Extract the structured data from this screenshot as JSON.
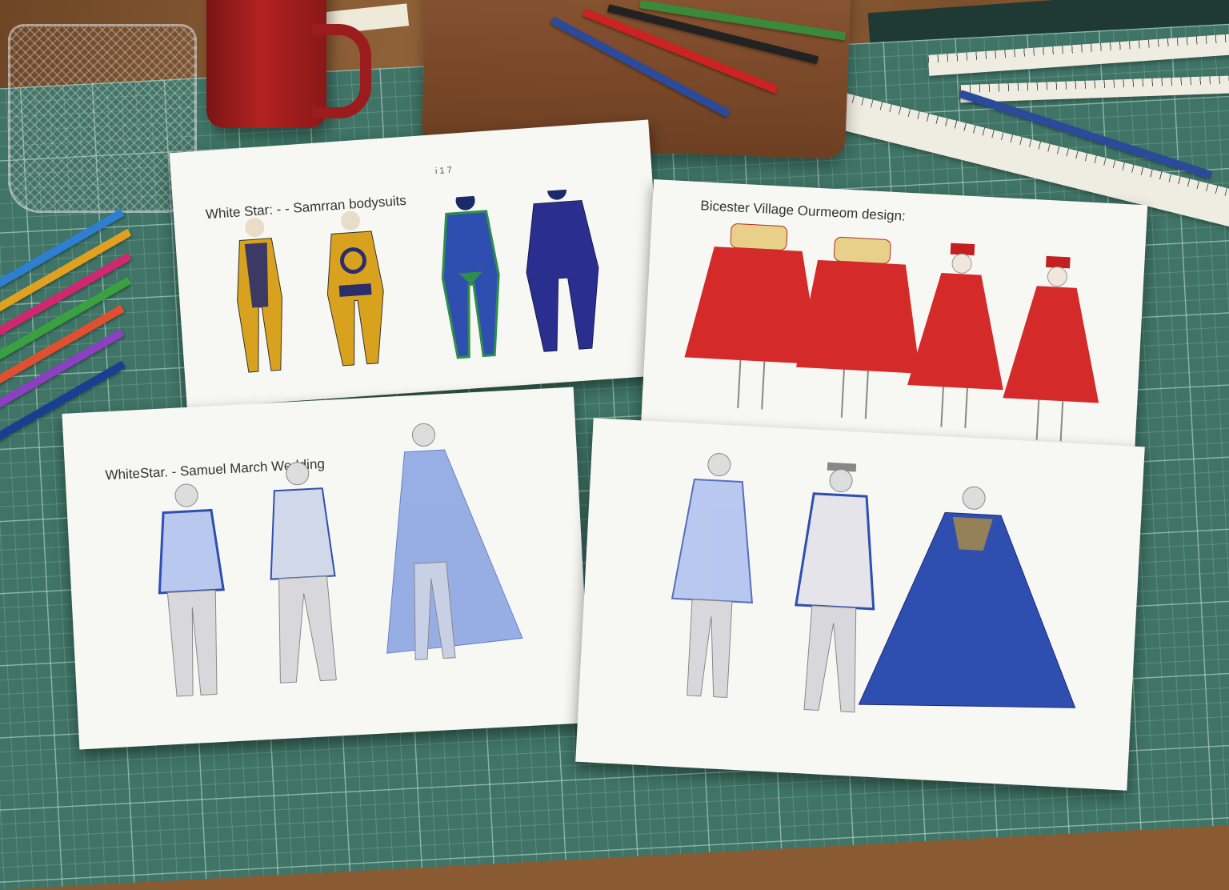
{
  "sheets": [
    {
      "title": "White Star: - - Samrran bodysuits",
      "caption": "",
      "top_marks": "i  1 7"
    },
    {
      "title": "Bicester Village Ourmeom design:",
      "caption": ""
    },
    {
      "title": "WhiteStar. - Samuel March Wedding",
      "caption": ""
    },
    {
      "title": "",
      "caption": ""
    }
  ],
  "colors": {
    "mat": "#3f7466",
    "mustard": "#d9a21e",
    "navy": "#2a2f6b",
    "royal_blue": "#2e4fb0",
    "green": "#2f8f4a",
    "red_cape": "#d42a2a",
    "mug_red": "#b32222",
    "leather": "#8b5634"
  }
}
